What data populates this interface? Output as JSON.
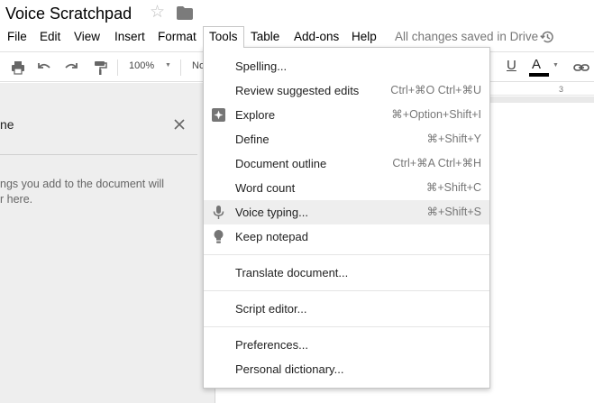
{
  "document": {
    "title": "Voice Scratchpad"
  },
  "menubar": {
    "items": [
      "File",
      "Edit",
      "View",
      "Insert",
      "Format",
      "Tools",
      "Table",
      "Add-ons",
      "Help"
    ],
    "saved_status": "All changes saved in Drive"
  },
  "toolbar": {
    "zoom": "100%",
    "style_partial": "No",
    "underline_label": "U",
    "text_color_label": "A",
    "text_color": "#000000"
  },
  "ruler": {
    "mark": "3"
  },
  "side_panel": {
    "title_partial": "ne",
    "hint_line1": "ngs you add to the document will",
    "hint_line2": "r here."
  },
  "tools_menu": {
    "items": [
      {
        "label": "Spelling...",
        "shortcut": ""
      },
      {
        "label": "Review suggested edits",
        "shortcut": "Ctrl+⌘O Ctrl+⌘U"
      },
      {
        "label": "Explore",
        "shortcut": "⌘+Option+Shift+I",
        "icon": "explore-icon"
      },
      {
        "label": "Define",
        "shortcut": "⌘+Shift+Y"
      },
      {
        "label": "Document outline",
        "shortcut": "Ctrl+⌘A Ctrl+⌘H"
      },
      {
        "label": "Word count",
        "shortcut": "⌘+Shift+C"
      },
      {
        "label": "Voice typing...",
        "shortcut": "⌘+Shift+S",
        "icon": "microphone-icon",
        "highlighted": true
      },
      {
        "label": "Keep notepad",
        "shortcut": "",
        "icon": "lightbulb-icon"
      },
      {
        "label": "Translate document...",
        "shortcut": ""
      },
      {
        "label": "Script editor...",
        "shortcut": ""
      },
      {
        "label": "Preferences...",
        "shortcut": ""
      },
      {
        "label": "Personal dictionary...",
        "shortcut": ""
      }
    ]
  },
  "colors": {
    "highlight": "#eeeeee",
    "panel_bg": "#eeeeee",
    "icon_gray": "#757575"
  }
}
